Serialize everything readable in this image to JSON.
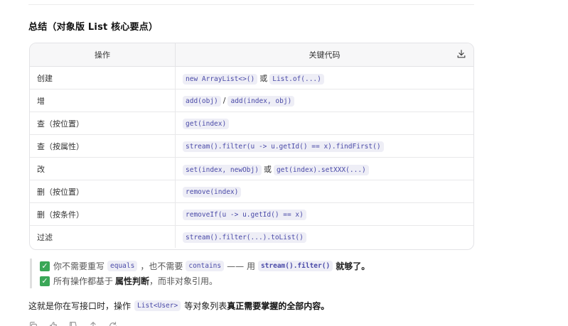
{
  "section_title": "总结（对象版 List 核心要点）",
  "table": {
    "headers": [
      "操作",
      "关键代码"
    ],
    "download_icon": "download-icon",
    "rows": [
      {
        "op": "创建",
        "code1": "new ArrayList<>()",
        "sep": "或",
        "code2": "List.of(...)"
      },
      {
        "op": "增",
        "code1": "add(obj)",
        "sep": "/",
        "code2": "add(index, obj)"
      },
      {
        "op": "查（按位置）",
        "code1": "get(index)",
        "sep": "",
        "code2": ""
      },
      {
        "op": "查（按属性）",
        "code1": "stream().filter(u -> u.getId() == x).findFirst()",
        "sep": "",
        "code2": ""
      },
      {
        "op": "改",
        "code1": "set(index, newObj)",
        "sep": "或",
        "code2": "get(index).setXXX(...)"
      },
      {
        "op": "删（按位置）",
        "code1": "remove(index)",
        "sep": "",
        "code2": ""
      },
      {
        "op": "删（按条件）",
        "code1": "removeIf(u -> u.getId() == x)",
        "sep": "",
        "code2": ""
      },
      {
        "op": "过滤",
        "code1": "stream().filter(...).toList()",
        "sep": "",
        "code2": ""
      }
    ]
  },
  "notes": {
    "line1": {
      "t1": "你不需要重写",
      "c1": "equals",
      "t2": "，也不需要",
      "c2": "contains",
      "t3": "—— 用",
      "c3": "stream().filter()",
      "t4": "就够了。"
    },
    "line2": {
      "t1": "所有操作都基于",
      "b1": "属性判断",
      "t2": "，而非对象引用。"
    }
  },
  "summary": {
    "t1": "这就是你在写接口时，操作",
    "c1": "List<User>",
    "t2": "等对象列表",
    "b1": "真正需要掌握的全部内容。"
  },
  "action_icons": [
    "copy-icon",
    "thumbs-up-icon",
    "thumbs-down-icon",
    "share-icon",
    "refresh-icon"
  ]
}
